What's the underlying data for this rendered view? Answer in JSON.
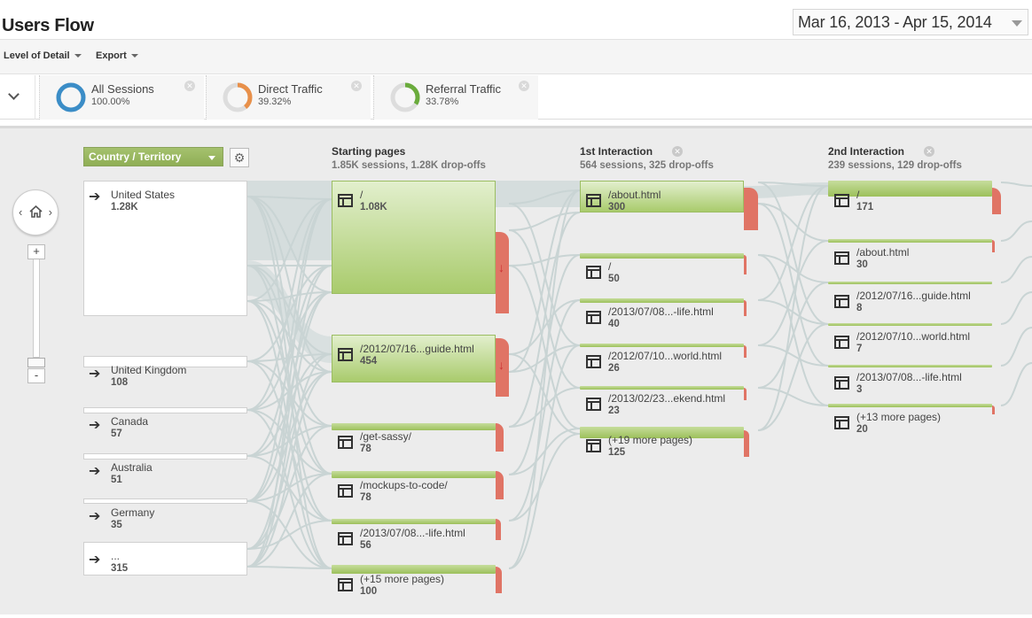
{
  "header": {
    "title": "Users Flow",
    "date_range": "Mar 16, 2013 - Apr 15, 2014"
  },
  "toolbar": {
    "level_of_detail": "Level of Detail",
    "export": "Export"
  },
  "segments": [
    {
      "name": "All Sessions",
      "pct": "100.00%",
      "color": "#3b8dc7",
      "fraction": 1.0
    },
    {
      "name": "Direct Traffic",
      "pct": "39.32%",
      "color": "#e8904a",
      "fraction": 0.3932
    },
    {
      "name": "Referral Traffic",
      "pct": "33.78%",
      "color": "#6aab3c",
      "fraction": 0.3378
    }
  ],
  "dimension": {
    "label": "Country / Territory"
  },
  "countries": [
    {
      "name": "United States",
      "value": "1.28K"
    },
    {
      "name": "United Kingdom",
      "value": "108"
    },
    {
      "name": "Canada",
      "value": "57"
    },
    {
      "name": "Australia",
      "value": "51"
    },
    {
      "name": "Germany",
      "value": "35"
    },
    {
      "name": "...",
      "value": "315"
    }
  ],
  "columns": [
    {
      "title": "Starting pages",
      "sub": "1.85K sessions, 1.28K drop-offs",
      "nodes": [
        {
          "name": "/",
          "value": "1.08K"
        },
        {
          "name": "/2012/07/16...guide.html",
          "value": "454"
        },
        {
          "name": "/get-sassy/",
          "value": "78"
        },
        {
          "name": "/mockups-to-code/",
          "value": "78"
        },
        {
          "name": "/2013/07/08...-life.html",
          "value": "56"
        },
        {
          "name": "(+15 more pages)",
          "value": "100"
        }
      ]
    },
    {
      "title": "1st Interaction",
      "sub": "564 sessions, 325 drop-offs",
      "nodes": [
        {
          "name": "/about.html",
          "value": "300"
        },
        {
          "name": "/",
          "value": "50"
        },
        {
          "name": "/2013/07/08...-life.html",
          "value": "40"
        },
        {
          "name": "/2012/07/10...world.html",
          "value": "26"
        },
        {
          "name": "/2013/02/23...ekend.html",
          "value": "23"
        },
        {
          "name": "(+19 more pages)",
          "value": "125"
        }
      ]
    },
    {
      "title": "2nd Interaction",
      "sub": "239 sessions, 129 drop-offs",
      "nodes": [
        {
          "name": "/",
          "value": "171"
        },
        {
          "name": "/about.html",
          "value": "30"
        },
        {
          "name": "/2012/07/16...guide.html",
          "value": "8"
        },
        {
          "name": "/2012/07/10...world.html",
          "value": "7"
        },
        {
          "name": "/2013/07/08...-life.html",
          "value": "3"
        },
        {
          "name": "(+13 more pages)",
          "value": "20"
        }
      ]
    }
  ],
  "colors": {
    "node_green": "#a9cb6c",
    "dropoff_red": "#e07465",
    "flow_gray": "#d3dcdc",
    "ring_track": "#dddddd"
  }
}
